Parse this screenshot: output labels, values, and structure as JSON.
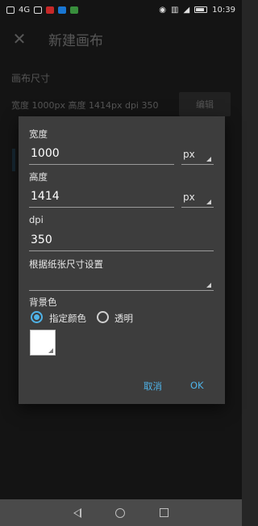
{
  "status_bar": {
    "network": "4G",
    "time": "10:39"
  },
  "app_bar": {
    "close_icon": "close-icon",
    "title": "新建画布"
  },
  "background": {
    "section_title": "画布尺寸",
    "size_summary": "宽度 1000px  高度 1414px  dpi 350",
    "edit_label": "编辑"
  },
  "dialog": {
    "width_label": "宽度",
    "width_value": "1000",
    "width_unit": "px",
    "height_label": "高度",
    "height_value": "1414",
    "height_unit": "px",
    "dpi_label": "dpi",
    "dpi_value": "350",
    "paper_size_label": "根据纸张尺寸设置",
    "paper_size_value": "",
    "bg_color_label": "背景色",
    "bg_options": [
      {
        "label": "指定颜色",
        "checked": true
      },
      {
        "label": "透明",
        "checked": false
      }
    ],
    "swatch_color": "#ffffff",
    "cancel_label": "取消",
    "ok_label": "OK",
    "accent_color": "#4fb3e8"
  },
  "nav_bar": {
    "back_icon": "back-icon",
    "home_icon": "home-icon",
    "recent_icon": "recent-apps-icon"
  }
}
